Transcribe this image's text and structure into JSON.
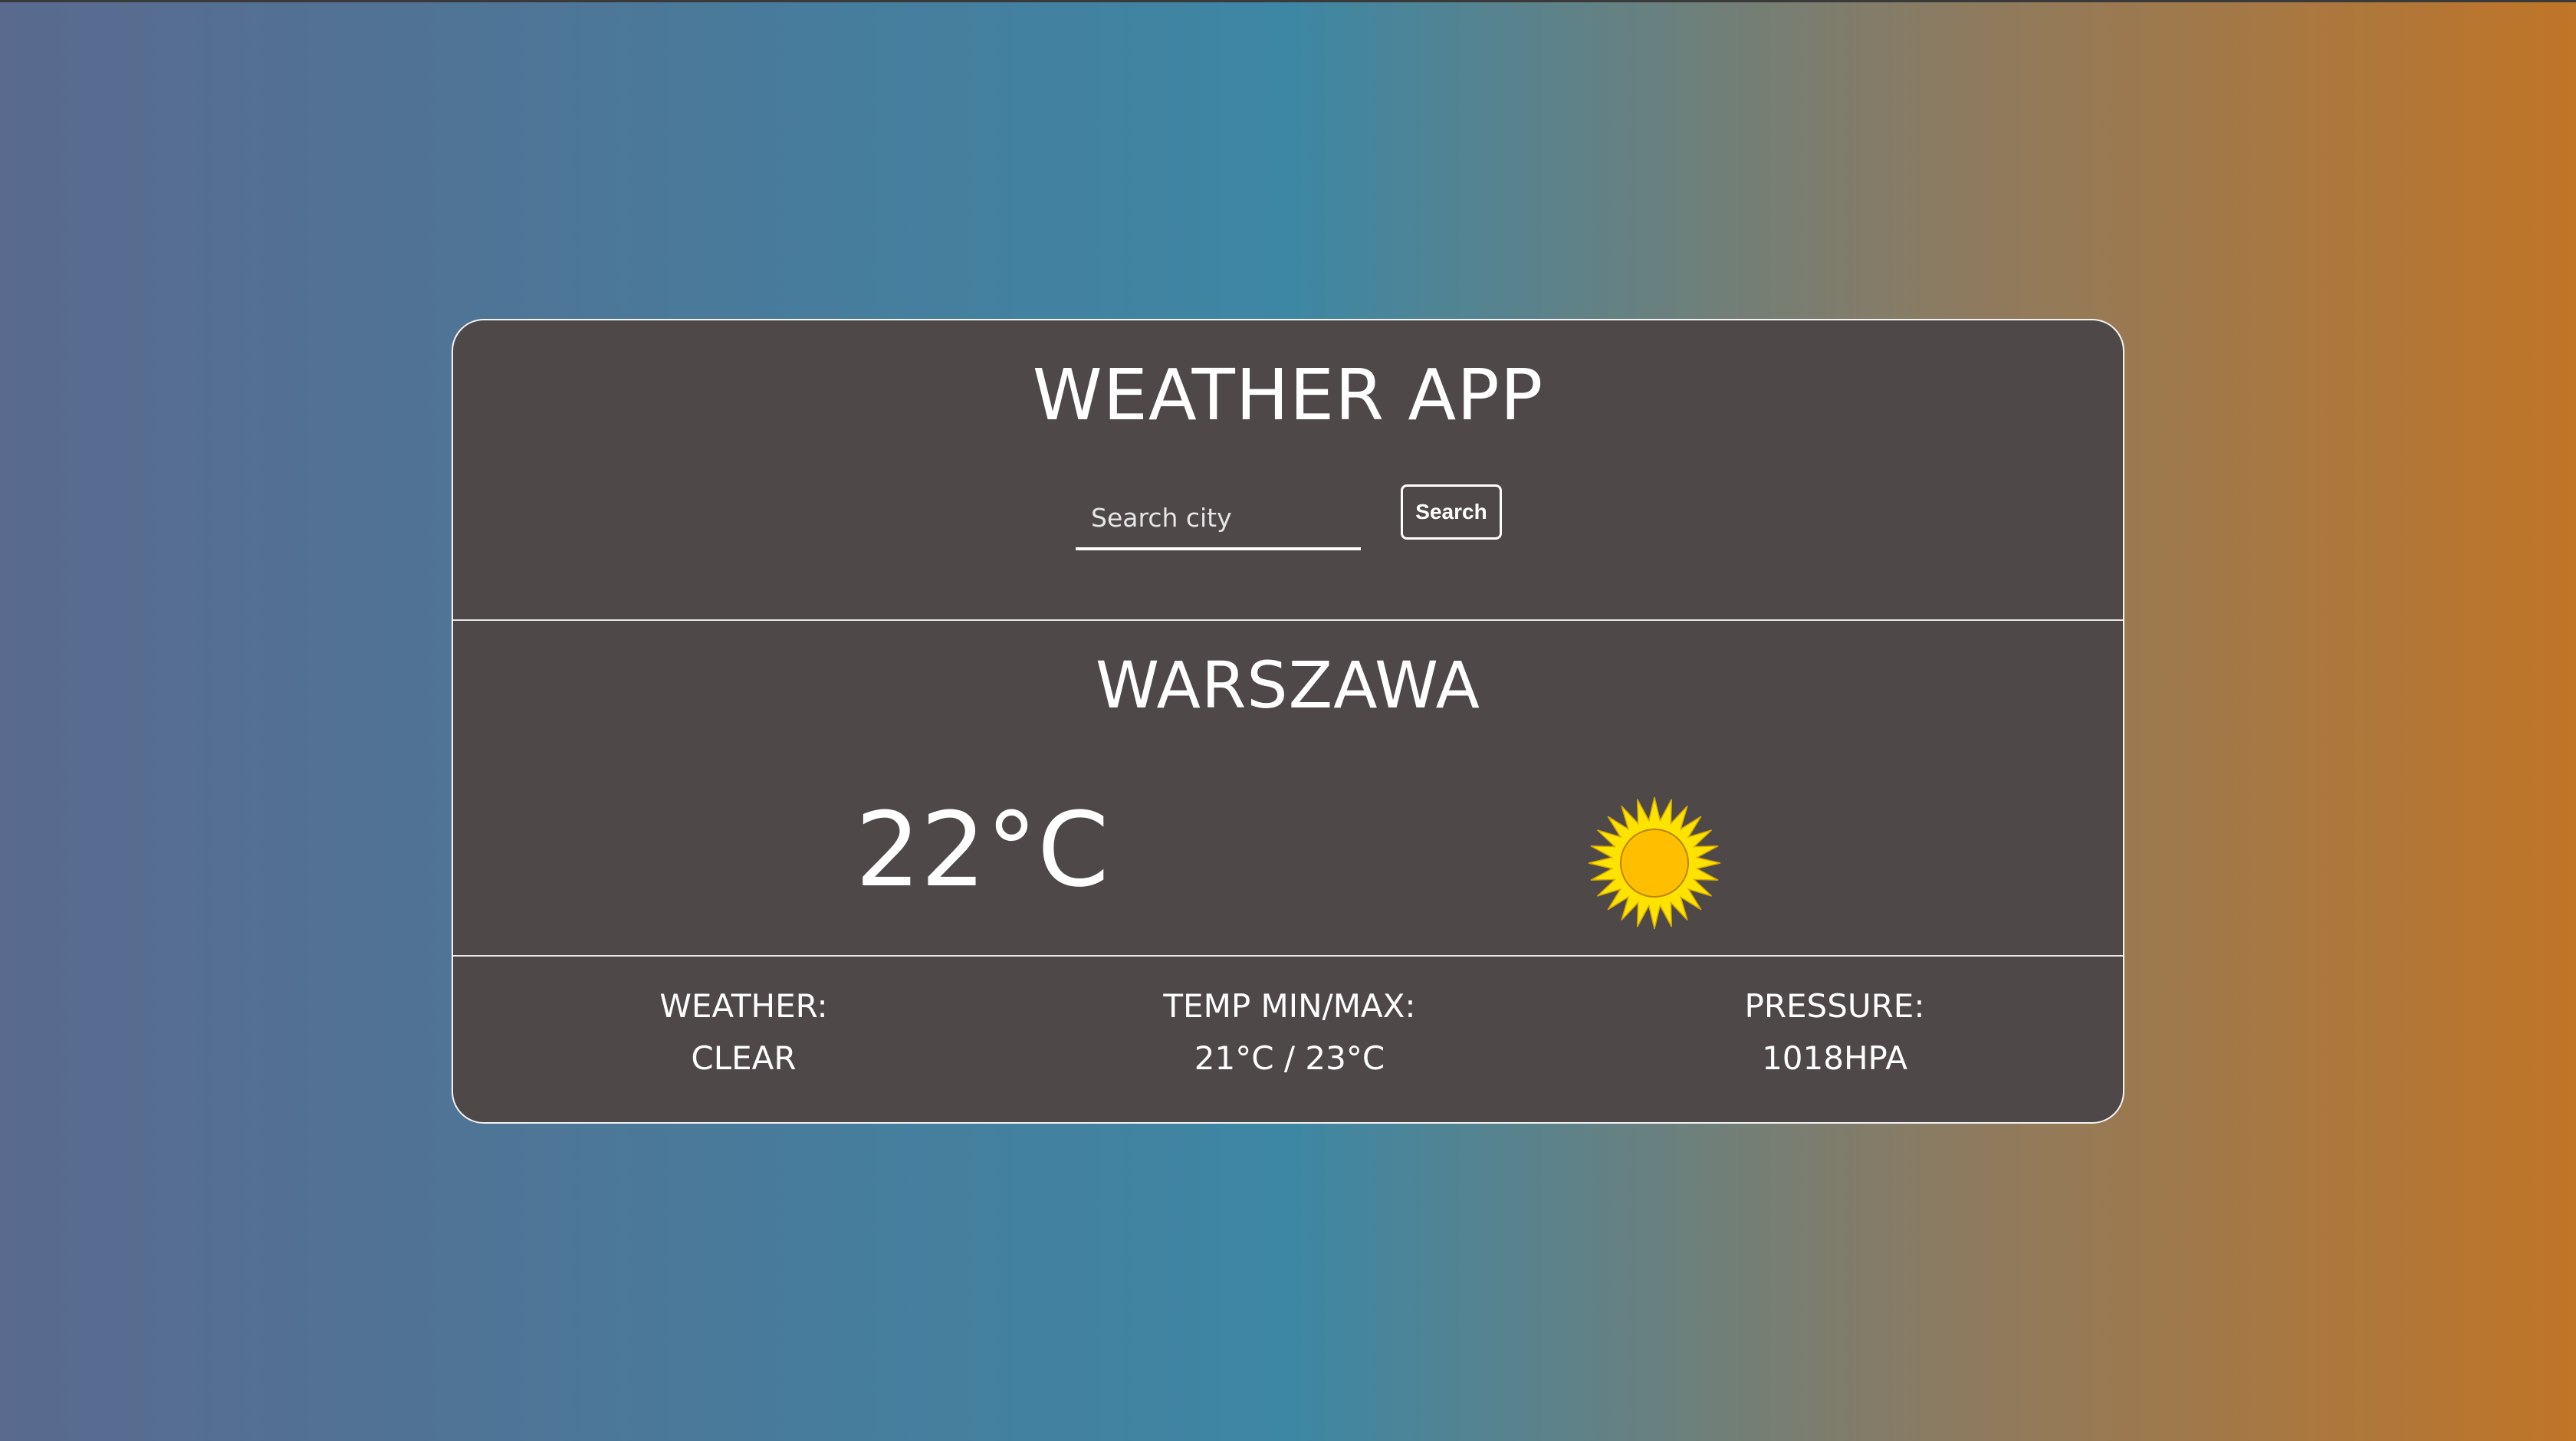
{
  "app": {
    "title": "WEATHER APP"
  },
  "search": {
    "placeholder": "Search city",
    "value": "",
    "button_label": "Search"
  },
  "current": {
    "city": "WARSZAWA",
    "temperature": "22°C",
    "icon": "sun-icon"
  },
  "details": [
    {
      "label": "WEATHER:",
      "value": "CLEAR"
    },
    {
      "label": "TEMP MIN/MAX:",
      "value": "21°C / 23°C"
    },
    {
      "label": "PRESSURE:",
      "value": "1018HPA"
    }
  ],
  "colors": {
    "card_background": "#4f4848",
    "text": "#ffffff",
    "gradient_left": "#596a8e",
    "gradient_middle": "#3d87a4",
    "gradient_right": "#c07527",
    "sun_rays": "#ffe300",
    "sun_core": "#ffbf00"
  }
}
